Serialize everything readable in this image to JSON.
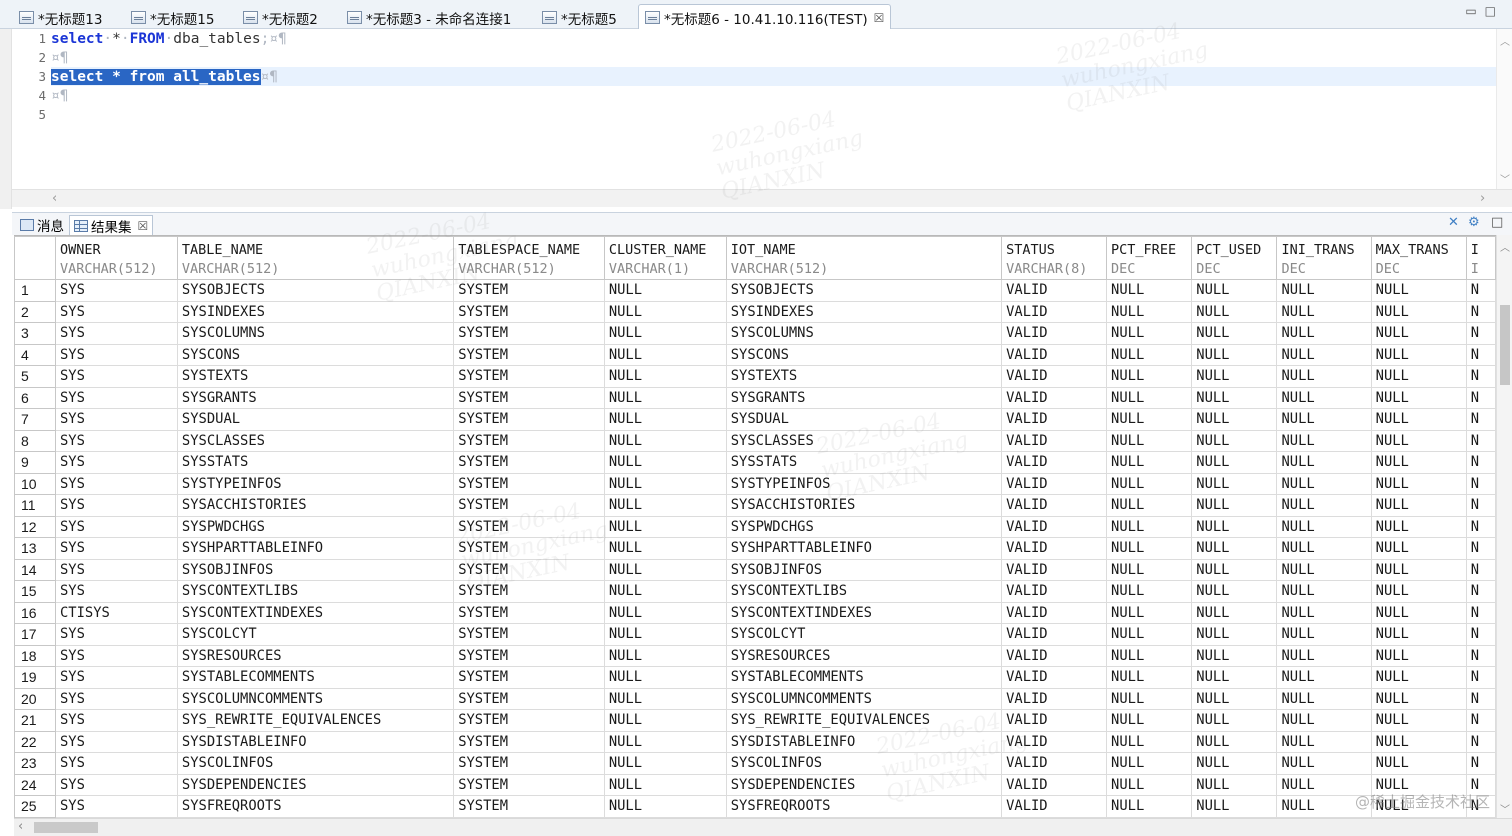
{
  "tabs": [
    {
      "label": "*无标题13",
      "active": false
    },
    {
      "label": "*无标题15",
      "active": false
    },
    {
      "label": "*无标题2",
      "active": false
    },
    {
      "label": "*无标题3 - 未命名连接1",
      "active": false
    },
    {
      "label": "*无标题5",
      "active": false
    },
    {
      "label": "*无标题6 - 10.41.10.116(TEST)",
      "active": true
    }
  ],
  "editor": {
    "line_numbers": [
      "1",
      "2",
      "3",
      "4",
      "5"
    ],
    "line1": {
      "kw1": "select",
      "star": "*",
      "kw2": "FROM",
      "table": "dba_tables",
      "tail": ";¤¶"
    },
    "line2": "¤¶",
    "line3": {
      "selected": "select * from all_tables",
      "tail": "¤¶"
    },
    "line4": "¤¶"
  },
  "results_panel": {
    "tab_messages": "消息",
    "tab_resultset": "结果集",
    "tab_close": "☒"
  },
  "grid": {
    "columns": [
      {
        "name": "OWNER",
        "type": "VARCHAR(512)"
      },
      {
        "name": "TABLE_NAME",
        "type": "VARCHAR(512)"
      },
      {
        "name": "TABLESPACE_NAME",
        "type": "VARCHAR(512)"
      },
      {
        "name": "CLUSTER_NAME",
        "type": "VARCHAR(1)"
      },
      {
        "name": "IOT_NAME",
        "type": "VARCHAR(512)"
      },
      {
        "name": "STATUS",
        "type": "VARCHAR(8)"
      },
      {
        "name": "PCT_FREE",
        "type": "DEC"
      },
      {
        "name": "PCT_USED",
        "type": "DEC"
      },
      {
        "name": "INI_TRANS",
        "type": "DEC"
      },
      {
        "name": "MAX_TRANS",
        "type": "DEC"
      },
      {
        "name": "I",
        "type": "I"
      }
    ],
    "rows": [
      [
        "1",
        "SYS",
        "SYSOBJECTS",
        "SYSTEM",
        "NULL",
        "SYSOBJECTS",
        "VALID",
        "NULL",
        "NULL",
        "NULL",
        "NULL",
        "N"
      ],
      [
        "2",
        "SYS",
        "SYSINDEXES",
        "SYSTEM",
        "NULL",
        "SYSINDEXES",
        "VALID",
        "NULL",
        "NULL",
        "NULL",
        "NULL",
        "N"
      ],
      [
        "3",
        "SYS",
        "SYSCOLUMNS",
        "SYSTEM",
        "NULL",
        "SYSCOLUMNS",
        "VALID",
        "NULL",
        "NULL",
        "NULL",
        "NULL",
        "N"
      ],
      [
        "4",
        "SYS",
        "SYSCONS",
        "SYSTEM",
        "NULL",
        "SYSCONS",
        "VALID",
        "NULL",
        "NULL",
        "NULL",
        "NULL",
        "N"
      ],
      [
        "5",
        "SYS",
        "SYSTEXTS",
        "SYSTEM",
        "NULL",
        "SYSTEXTS",
        "VALID",
        "NULL",
        "NULL",
        "NULL",
        "NULL",
        "N"
      ],
      [
        "6",
        "SYS",
        "SYSGRANTS",
        "SYSTEM",
        "NULL",
        "SYSGRANTS",
        "VALID",
        "NULL",
        "NULL",
        "NULL",
        "NULL",
        "N"
      ],
      [
        "7",
        "SYS",
        "SYSDUAL",
        "SYSTEM",
        "NULL",
        "SYSDUAL",
        "VALID",
        "NULL",
        "NULL",
        "NULL",
        "NULL",
        "N"
      ],
      [
        "8",
        "SYS",
        "SYSCLASSES",
        "SYSTEM",
        "NULL",
        "SYSCLASSES",
        "VALID",
        "NULL",
        "NULL",
        "NULL",
        "NULL",
        "N"
      ],
      [
        "9",
        "SYS",
        "SYSSTATS",
        "SYSTEM",
        "NULL",
        "SYSSTATS",
        "VALID",
        "NULL",
        "NULL",
        "NULL",
        "NULL",
        "N"
      ],
      [
        "10",
        "SYS",
        "SYSTYPEINFOS",
        "SYSTEM",
        "NULL",
        "SYSTYPEINFOS",
        "VALID",
        "NULL",
        "NULL",
        "NULL",
        "NULL",
        "N"
      ],
      [
        "11",
        "SYS",
        "SYSACCHISTORIES",
        "SYSTEM",
        "NULL",
        "SYSACCHISTORIES",
        "VALID",
        "NULL",
        "NULL",
        "NULL",
        "NULL",
        "N"
      ],
      [
        "12",
        "SYS",
        "SYSPWDCHGS",
        "SYSTEM",
        "NULL",
        "SYSPWDCHGS",
        "VALID",
        "NULL",
        "NULL",
        "NULL",
        "NULL",
        "N"
      ],
      [
        "13",
        "SYS",
        "SYSHPARTTABLEINFO",
        "SYSTEM",
        "NULL",
        "SYSHPARTTABLEINFO",
        "VALID",
        "NULL",
        "NULL",
        "NULL",
        "NULL",
        "N"
      ],
      [
        "14",
        "SYS",
        "SYSOBJINFOS",
        "SYSTEM",
        "NULL",
        "SYSOBJINFOS",
        "VALID",
        "NULL",
        "NULL",
        "NULL",
        "NULL",
        "N"
      ],
      [
        "15",
        "SYS",
        "SYSCONTEXTLIBS",
        "SYSTEM",
        "NULL",
        "SYSCONTEXTLIBS",
        "VALID",
        "NULL",
        "NULL",
        "NULL",
        "NULL",
        "N"
      ],
      [
        "16",
        "CTISYS",
        "SYSCONTEXTINDEXES",
        "SYSTEM",
        "NULL",
        "SYSCONTEXTINDEXES",
        "VALID",
        "NULL",
        "NULL",
        "NULL",
        "NULL",
        "N"
      ],
      [
        "17",
        "SYS",
        "SYSCOLCYT",
        "SYSTEM",
        "NULL",
        "SYSCOLCYT",
        "VALID",
        "NULL",
        "NULL",
        "NULL",
        "NULL",
        "N"
      ],
      [
        "18",
        "SYS",
        "SYSRESOURCES",
        "SYSTEM",
        "NULL",
        "SYSRESOURCES",
        "VALID",
        "NULL",
        "NULL",
        "NULL",
        "NULL",
        "N"
      ],
      [
        "19",
        "SYS",
        "SYSTABLECOMMENTS",
        "SYSTEM",
        "NULL",
        "SYSTABLECOMMENTS",
        "VALID",
        "NULL",
        "NULL",
        "NULL",
        "NULL",
        "N"
      ],
      [
        "20",
        "SYS",
        "SYSCOLUMNCOMMENTS",
        "SYSTEM",
        "NULL",
        "SYSCOLUMNCOMMENTS",
        "VALID",
        "NULL",
        "NULL",
        "NULL",
        "NULL",
        "N"
      ],
      [
        "21",
        "SYS",
        "SYS_REWRITE_EQUIVALENCES",
        "SYSTEM",
        "NULL",
        "SYS_REWRITE_EQUIVALENCES",
        "VALID",
        "NULL",
        "NULL",
        "NULL",
        "NULL",
        "N"
      ],
      [
        "22",
        "SYS",
        "SYSDISTABLEINFO",
        "SYSTEM",
        "NULL",
        "SYSDISTABLEINFO",
        "VALID",
        "NULL",
        "NULL",
        "NULL",
        "NULL",
        "N"
      ],
      [
        "23",
        "SYS",
        "SYSCOLINFOS",
        "SYSTEM",
        "NULL",
        "SYSCOLINFOS",
        "VALID",
        "NULL",
        "NULL",
        "NULL",
        "NULL",
        "N"
      ],
      [
        "24",
        "SYS",
        "SYSDEPENDENCIES",
        "SYSTEM",
        "NULL",
        "SYSDEPENDENCIES",
        "VALID",
        "NULL",
        "NULL",
        "NULL",
        "NULL",
        "N"
      ],
      [
        "25",
        "SYS",
        "SYSFREQROOTS",
        "SYSTEM",
        "NULL",
        "SYSFREQROOTS",
        "VALID",
        "NULL",
        "NULL",
        "NULL",
        "NULL",
        "N"
      ]
    ]
  },
  "watermark_attribution": "@稀土掘金技术社区",
  "watermark": {
    "date": "2022-06-04",
    "user": "wuhongxiang",
    "org": "QIANXIN"
  },
  "colors": {
    "keyword": "#1b35d6",
    "selection": "#2a66c4",
    "current_line": "#e8f2fe"
  }
}
